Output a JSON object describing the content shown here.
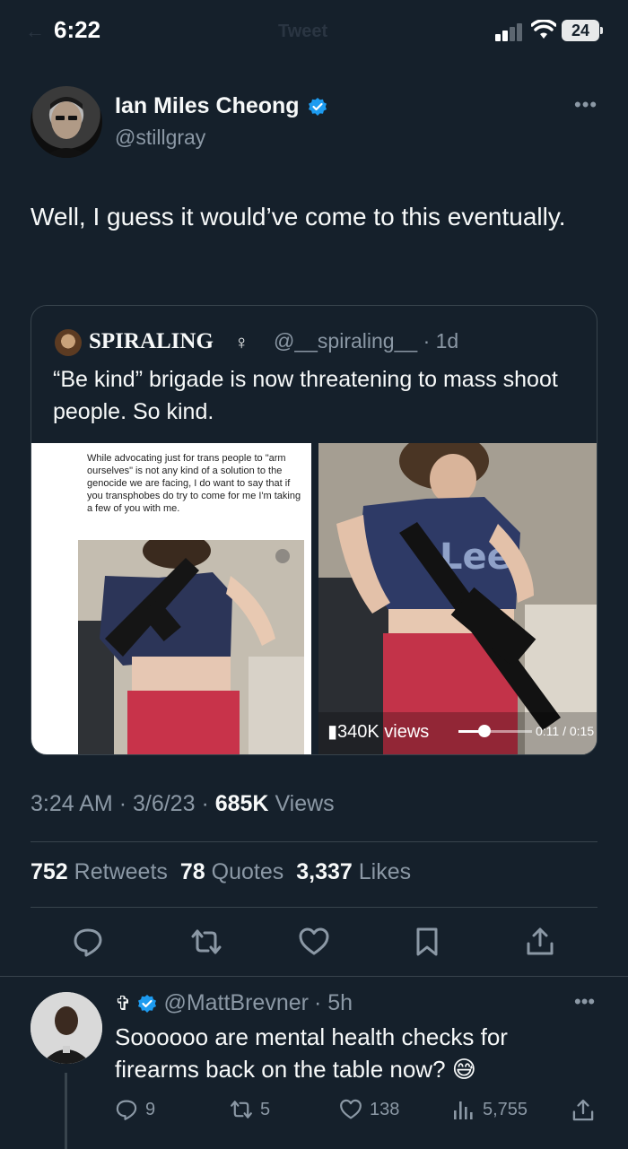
{
  "status_bar": {
    "time": "6:22",
    "header_title": "Tweet",
    "battery": "24"
  },
  "tweet": {
    "author_name": "Ian Miles Cheong",
    "author_handle": "@stillgray",
    "text": "Well, I guess it would’ve come to this eventually.",
    "quote": {
      "name": "SPIRALING",
      "symbol": "♀",
      "handle": "@__spiraling__",
      "age": "· 1d",
      "text": "“Be kind” brigade is now threatening to mass shoot people. So kind.",
      "media_left_text": "While advocating just for trans people to \"arm ourselves\" is not any kind of a solution to the genocide we are facing, I do want to say that if you transphobes do try to come for me I'm taking a few of you with me.",
      "media_views": "340K views",
      "media_time": "0:11 / 0:15"
    },
    "time": "3:24 AM",
    "date": "3/6/23",
    "views_count": "685K",
    "views_label": "Views",
    "retweets_count": "752",
    "retweets_label": "Retweets",
    "quotes_count": "78",
    "quotes_label": "Quotes",
    "likes_count": "3,337",
    "likes_label": "Likes"
  },
  "reply": {
    "prefix_symbol": "✞",
    "handle": "@MattBrevner",
    "age": "· 5h",
    "text": "Soooooo are mental health checks for firearms back on the table now? 😅",
    "replies": "9",
    "retweets": "5",
    "likes": "138",
    "views": "5,755"
  },
  "colors": {
    "background": "#15202b",
    "accent": "#1d9bf0",
    "muted": "#8b98a5",
    "border": "#38444d"
  }
}
